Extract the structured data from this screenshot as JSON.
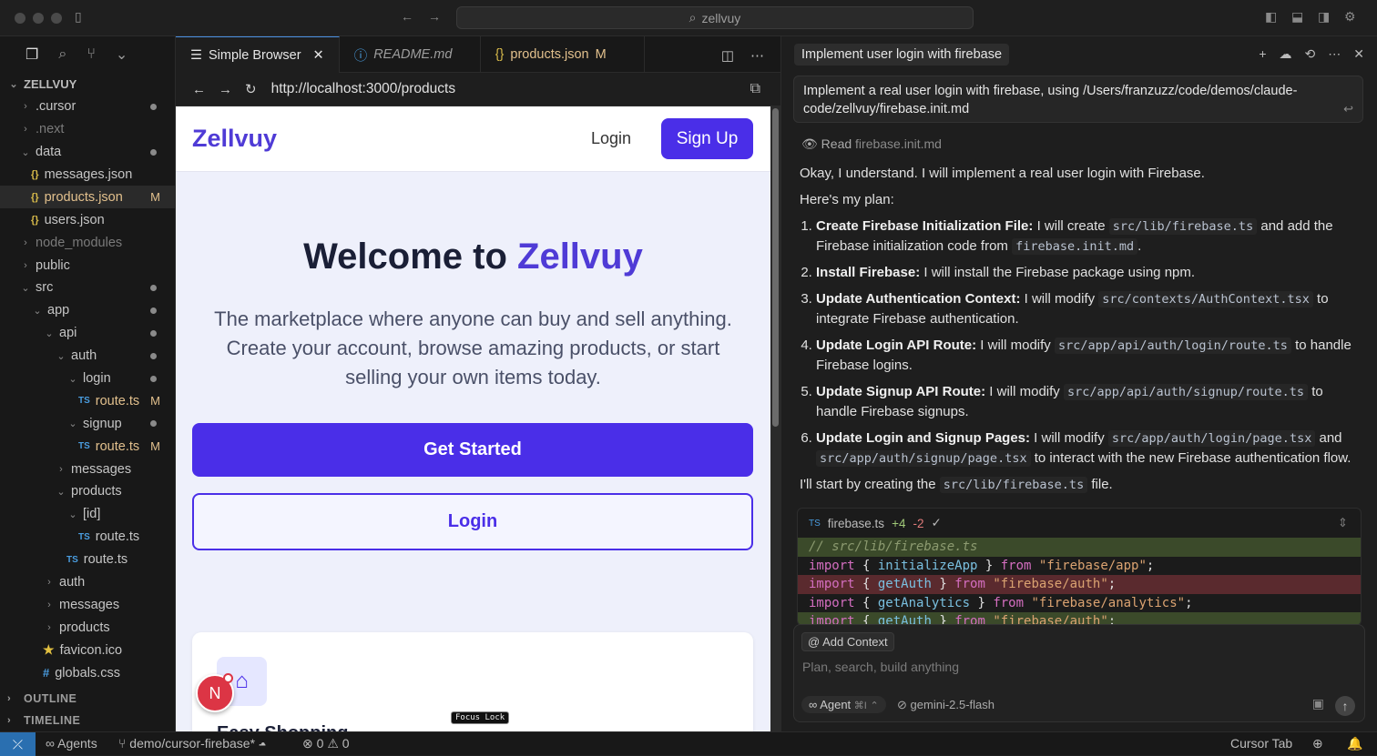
{
  "titlebar": {
    "search": "zellvuy"
  },
  "explorer": {
    "root": "ZELLVUY",
    "items": [
      {
        "label": ".cursor",
        "kind": "folder",
        "depth": 1,
        "open": false,
        "mark": "dot"
      },
      {
        "label": ".next",
        "kind": "folder",
        "depth": 1,
        "open": false,
        "mark": "",
        "dim": true
      },
      {
        "label": "data",
        "kind": "folder",
        "depth": 1,
        "open": true,
        "mark": "dot"
      },
      {
        "label": "messages.json",
        "kind": "json",
        "depth": 2,
        "mark": ""
      },
      {
        "label": "products.json",
        "kind": "json",
        "depth": 2,
        "mark": "M",
        "selected": true
      },
      {
        "label": "users.json",
        "kind": "json",
        "depth": 2,
        "mark": ""
      },
      {
        "label": "node_modules",
        "kind": "folder",
        "depth": 1,
        "open": false,
        "mark": "",
        "dim": true
      },
      {
        "label": "public",
        "kind": "folder",
        "depth": 1,
        "open": false,
        "mark": ""
      },
      {
        "label": "src",
        "kind": "folder",
        "depth": 1,
        "open": true,
        "mark": "dot"
      },
      {
        "label": "app",
        "kind": "folder",
        "depth": 2,
        "open": true,
        "mark": "dot"
      },
      {
        "label": "api",
        "kind": "folder",
        "depth": 3,
        "open": true,
        "mark": "dot"
      },
      {
        "label": "auth",
        "kind": "folder",
        "depth": 4,
        "open": true,
        "mark": "dot"
      },
      {
        "label": "login",
        "kind": "folder",
        "depth": 5,
        "open": true,
        "mark": "dot"
      },
      {
        "label": "route.ts",
        "kind": "ts",
        "depth": 6,
        "mark": "M"
      },
      {
        "label": "signup",
        "kind": "folder",
        "depth": 5,
        "open": true,
        "mark": "dot"
      },
      {
        "label": "route.ts",
        "kind": "ts",
        "depth": 6,
        "mark": "M"
      },
      {
        "label": "messages",
        "kind": "folder",
        "depth": 4,
        "open": false,
        "mark": ""
      },
      {
        "label": "products",
        "kind": "folder",
        "depth": 4,
        "open": true,
        "mark": ""
      },
      {
        "label": "[id]",
        "kind": "folder",
        "depth": 5,
        "open": true,
        "mark": ""
      },
      {
        "label": "route.ts",
        "kind": "ts",
        "depth": 6,
        "mark": ""
      },
      {
        "label": "route.ts",
        "kind": "ts",
        "depth": 5,
        "mark": ""
      },
      {
        "label": "auth",
        "kind": "folder",
        "depth": 3,
        "open": false,
        "mark": ""
      },
      {
        "label": "messages",
        "kind": "folder",
        "depth": 3,
        "open": false,
        "mark": ""
      },
      {
        "label": "products",
        "kind": "folder",
        "depth": 3,
        "open": false,
        "mark": ""
      },
      {
        "label": "favicon.ico",
        "kind": "star",
        "depth": 3,
        "mark": ""
      },
      {
        "label": "globals.css",
        "kind": "css",
        "depth": 3,
        "mark": ""
      }
    ],
    "outline": "OUTLINE",
    "timeline": "TIMELINE"
  },
  "tabs": [
    {
      "label": "Simple Browser",
      "active": true
    },
    {
      "label": "README.md",
      "italic": true
    },
    {
      "label": "products.json",
      "badge": "M"
    }
  ],
  "browser": {
    "url": "http://localhost:3000/products",
    "site": {
      "logo": "Zellvuy",
      "nav_login": "Login",
      "signup": "Sign Up",
      "hero_prefix": "Welcome to ",
      "hero_brand": "Zellvuy",
      "hero_sub": "The marketplace where anyone can buy and sell anything. Create your account, browse amazing products, or start selling your own items today.",
      "get_started": "Get Started",
      "login_btn": "Login",
      "card_title": "Easy Shopping",
      "avatar_letter": "N",
      "focus_lock": "Focus Lock"
    }
  },
  "chat": {
    "title": "Implement user login with firebase",
    "prompt": "Implement a real user login with firebase, using /Users/franzuzz/code/demos/claude-code/zellvuy/firebase.init.md",
    "read_label": "Read",
    "read_file": "firebase.init.md",
    "intro": "Okay, I understand. I will implement a real user login with Firebase.",
    "plan_label": "Here's my plan:",
    "steps": [
      {
        "title": "Create Firebase Initialization File:",
        "pre": " I will create ",
        "code1": "src/lib/firebase.ts",
        "mid": " and add the Firebase initialization code from ",
        "code2": "firebase.init.md",
        "post": "."
      },
      {
        "title": "Install Firebase:",
        "pre": " I will install the Firebase package using npm.",
        "code1": "",
        "mid": "",
        "code2": "",
        "post": ""
      },
      {
        "title": "Update Authentication Context:",
        "pre": " I will modify ",
        "code1": "src/contexts/AuthContext.tsx",
        "mid": " to integrate Firebase authentication.",
        "code2": "",
        "post": ""
      },
      {
        "title": "Update Login API Route:",
        "pre": " I will modify ",
        "code1": "src/app/api/auth/login/route.ts",
        "mid": " to handle Firebase logins.",
        "code2": "",
        "post": ""
      },
      {
        "title": "Update Signup API Route:",
        "pre": " I will modify ",
        "code1": "src/app/api/auth/signup/route.ts",
        "mid": " to handle Firebase signups.",
        "code2": "",
        "post": ""
      },
      {
        "title": "Update Login and Signup Pages:",
        "pre": " I will modify ",
        "code1": "src/app/auth/login/page.tsx",
        "mid": " and ",
        "code2": "src/app/auth/signup/page.tsx",
        "post": " to interact with the new Firebase authentication flow."
      }
    ],
    "closing_pre": "I'll start by creating the ",
    "closing_code": "src/lib/firebase.ts",
    "closing_post": " file.",
    "diff": {
      "file": "firebase.ts",
      "added": "+4",
      "removed": "-2",
      "lines": [
        {
          "type": "comment",
          "text": "// src/lib/firebase.ts"
        },
        {
          "type": "normal",
          "k1": "import",
          "mid": " { ",
          "f": "initializeApp",
          "mid2": " } ",
          "k2": "from",
          "s": " \"firebase/app\"",
          "end": ";"
        },
        {
          "type": "del",
          "k1": "import",
          "mid": " { ",
          "f": "getAuth",
          "mid2": " } ",
          "k2": "from",
          "s": " \"firebase/auth\"",
          "end": ";"
        },
        {
          "type": "normal",
          "k1": "import",
          "mid": " { ",
          "f": "getAnalytics",
          "mid2": " } ",
          "k2": "from",
          "s": " \"firebase/analytics\"",
          "end": ";"
        },
        {
          "type": "add",
          "k1": "import",
          "mid": " { ",
          "f": "getAuth",
          "mid2": " } ",
          "k2": "from",
          "s": " \"firebase/auth\"",
          "end": ";"
        }
      ]
    },
    "composer": {
      "add_context": "Add Context",
      "placeholder": "Plan, search, build anything",
      "agent": "Agent",
      "agent_kbd": "⌘I",
      "model": "gemini-2.5-flash"
    }
  },
  "statusbar": {
    "agents": "Agents",
    "branch": "demo/cursor-firebase*",
    "errors": "0",
    "warnings": "0",
    "cursor_tab": "Cursor Tab"
  },
  "colors": {
    "brand": "#4a2ee8",
    "accent": "#4f3bd6",
    "modified": "#e2c08d"
  }
}
